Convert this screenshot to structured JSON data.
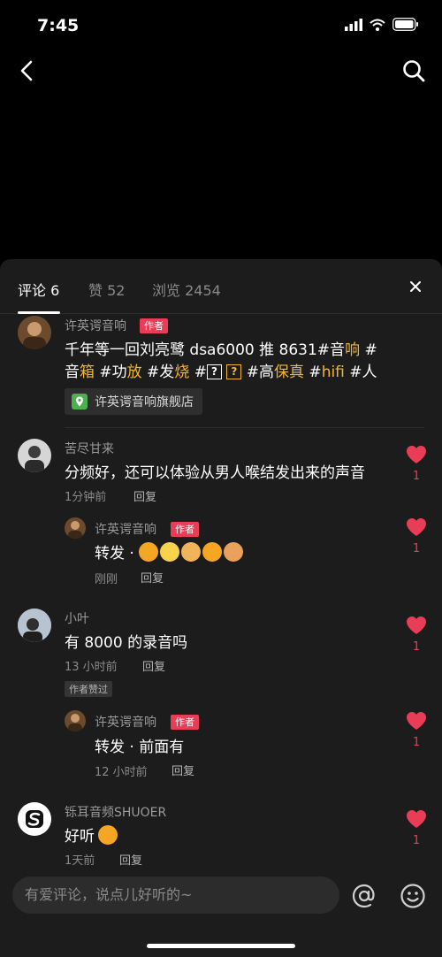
{
  "status": {
    "time": "7:45"
  },
  "tabs": [
    {
      "label": "评论 6"
    },
    {
      "label": "赞 52"
    },
    {
      "label": "浏览 2454"
    }
  ],
  "post": {
    "author": "许英谔音响",
    "author_tag": "作者",
    "text_line1_a": "千年等一回刘亮鹭 dsa6000 推 8631#音",
    "text_line1_b": "响",
    "text_line1_c": " #",
    "text_line2": {
      "a": "音",
      "b": "箱",
      "c": " #功",
      "d": "放",
      "e": " #发",
      "f": "烧",
      "g": " #",
      "h": "?",
      "i": "?",
      "j": " #高",
      "k": "保真",
      "l": " #",
      "m": "hifi",
      "n": " #人"
    },
    "shop_label": "许英谔音响旗舰店"
  },
  "comments": [
    {
      "name": "苦尽甘来",
      "text": "分频好，还可以体验从男人喉结发出来的声音",
      "time": "1分钟前",
      "reply_label": "回复",
      "likes": "1",
      "sub": {
        "name": "许英谔音响",
        "tag": "作者",
        "text": "转发 · ",
        "time": "刚刚",
        "reply_label": "回复",
        "likes": "1"
      }
    },
    {
      "name": "小叶",
      "text": "有 8000 的录音吗",
      "time": "13 小时前",
      "reply_label": "回复",
      "badge": "作者赞过",
      "likes": "1",
      "sub": {
        "name": "许英谔音响",
        "tag": "作者",
        "text": "转发 · 前面有",
        "time": "12 小时前",
        "reply_label": "回复",
        "likes": "1"
      }
    },
    {
      "name": "铄耳音频SHUOER",
      "text": "好听",
      "time": "1天前",
      "reply_label": "回复",
      "likes": "1"
    }
  ],
  "input": {
    "placeholder": "有爱评论，说点儿好听的~"
  },
  "colors": {
    "accent": "#e93d57",
    "highlight": "#f2b630",
    "sheet_bg": "#1c1c1c"
  }
}
